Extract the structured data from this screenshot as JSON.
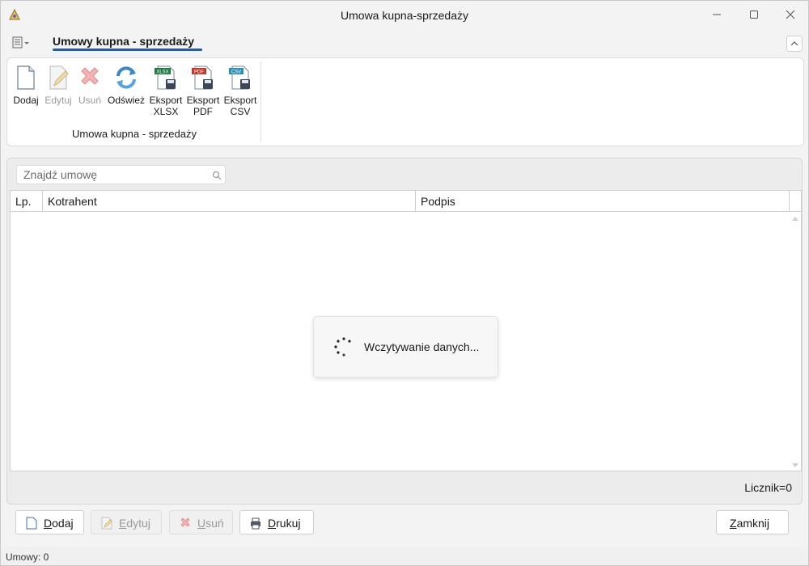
{
  "window": {
    "title": "Umowa kupna-sprzedaży"
  },
  "ribbon": {
    "tab_label": "Umowy kupna - sprzedaży",
    "group_label": "Umowa kupna - sprzedaży",
    "buttons": {
      "dodaj": "Dodaj",
      "edytuj": "Edytuj",
      "usun": "Usuń",
      "odswiez": "Odśwież",
      "xlsx_line1": "Eksport",
      "xlsx_line2": "XLSX",
      "pdf_line1": "Eksport",
      "pdf_line2": "PDF",
      "csv_line1": "Eksport",
      "csv_line2": "CSV"
    },
    "icon_badges": {
      "xlsx": "XLSX",
      "pdf": "PDF",
      "csv": "CSV"
    }
  },
  "search": {
    "placeholder": "Znajdź umowę",
    "value": ""
  },
  "grid": {
    "columns": [
      "Lp.",
      "Kotrahent",
      "Podpis"
    ],
    "rows": []
  },
  "loading": {
    "text": "Wczytywanie danych..."
  },
  "counter": {
    "text": "Licznik=0"
  },
  "footer_buttons": {
    "dodaj_first": "D",
    "dodaj_rest": "odaj",
    "edytuj_first": "E",
    "edytuj_rest": "dytuj",
    "usun_first": "U",
    "usun_rest": "suń",
    "drukuj_first": "D",
    "drukuj_rest": "rukuj",
    "zamknij_first": "Z",
    "zamknij_rest": "amknij"
  },
  "statusbar": {
    "text": "Umowy: 0"
  },
  "colors": {
    "accent": "#1f5fa9",
    "disabled_text": "#9a9a9a",
    "xlsx_green": "#1e7a45",
    "pdf_red": "#c0392b",
    "csv_teal": "#2a8fb0"
  }
}
